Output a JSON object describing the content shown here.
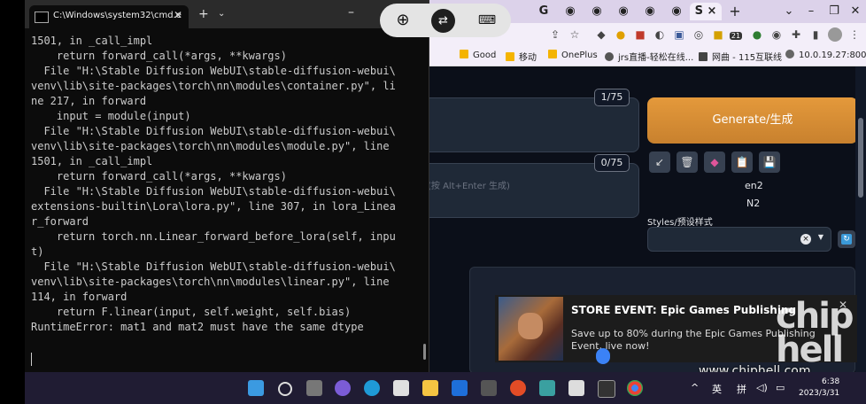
{
  "terminal": {
    "tab_title": "C:\\Windows\\system32\\cmd.e",
    "lines": [
      "1501, in _call_impl",
      "    return forward_call(*args, **kwargs)",
      "  File \"H:\\Stable Diffusion WebUI\\stable-diffusion-webui\\",
      "venv\\lib\\site-packages\\torch\\nn\\modules\\container.py\", li",
      "ne 217, in forward",
      "    input = module(input)",
      "  File \"H:\\Stable Diffusion WebUI\\stable-diffusion-webui\\",
      "venv\\lib\\site-packages\\torch\\nn\\modules\\module.py\", line",
      "1501, in _call_impl",
      "    return forward_call(*args, **kwargs)",
      "  File \"H:\\Stable Diffusion WebUI\\stable-diffusion-webui\\",
      "extensions-builtin\\Lora\\lora.py\", line 307, in lora_Linea",
      "r_forward",
      "    return torch.nn.Linear_forward_before_lora(self, inpu",
      "t)",
      "  File \"H:\\Stable Diffusion WebUI\\stable-diffusion-webui\\",
      "venv\\lib\\site-packages\\torch\\nn\\modules\\linear.py\", line",
      "114, in forward",
      "    return F.linear(input, self.weight, self.bias)",
      "RuntimeError: mat1 and mat2 must have the same dtype"
    ]
  },
  "browser": {
    "bookmarks": [
      "Good",
      "移动",
      "OnePlus",
      "jrs直播-轻松在线...",
      "网曲 - 115互联线",
      "10.0.19.27:800"
    ],
    "profile_badge": "21",
    "webui": {
      "prompt_counter": "1/75",
      "negative_counter": "0/75",
      "negative_placeholder": "(按 Alt+Enter 生成)",
      "generate_label": "Generate/生成",
      "tool_icons": [
        "↙",
        "🗑",
        "◆",
        "📋",
        "💾"
      ],
      "label_en2": "en2",
      "label_n2": "N2",
      "styles_label": "Styles/预设样式",
      "styles_clear": "×",
      "styles_refresh": "↻"
    }
  },
  "notification": {
    "title": "STORE EVENT: Epic Games Publishing",
    "body": "Save up to 80% during the Epic Games Publishing Event, live now!",
    "close": "✕"
  },
  "watermark": {
    "logo_text": "chip hell",
    "url": "www.chiphell.com"
  },
  "taskbar": {
    "tray_up": "^",
    "ime_lang": "英",
    "ime_mode": "拼",
    "time": "6:38",
    "date": "2023/3/31"
  },
  "colors": {
    "terminal_bg": "#0c0c0c",
    "generate_orange": "#d58a32",
    "taskbar_bg": "#201c33"
  }
}
